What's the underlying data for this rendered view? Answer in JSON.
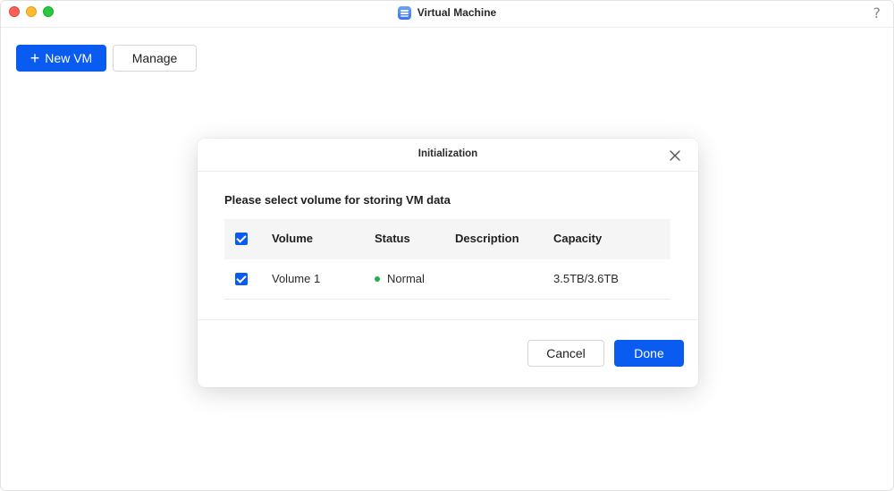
{
  "window": {
    "title": "Virtual Machine",
    "help_label": "?"
  },
  "toolbar": {
    "new_vm_icon": "+",
    "new_vm_label": "New VM",
    "manage_label": "Manage"
  },
  "dialog": {
    "title": "Initialization",
    "prompt": "Please select volume for storing VM data",
    "columns": {
      "volume": "Volume",
      "status": "Status",
      "description": "Description",
      "capacity": "Capacity"
    },
    "rows": [
      {
        "volume": "Volume 1",
        "status": "Normal",
        "description": "",
        "capacity": "3.5TB/3.6TB",
        "selected": true
      }
    ],
    "cancel_label": "Cancel",
    "done_label": "Done"
  },
  "colors": {
    "accent": "#0a5cf0",
    "status_normal": "#21b24b"
  },
  "icons": {
    "app": "virtual-machine-icon",
    "help": "help-icon",
    "close": "close-icon",
    "plus": "plus-icon",
    "checkbox": "checkbox-checked-icon"
  }
}
